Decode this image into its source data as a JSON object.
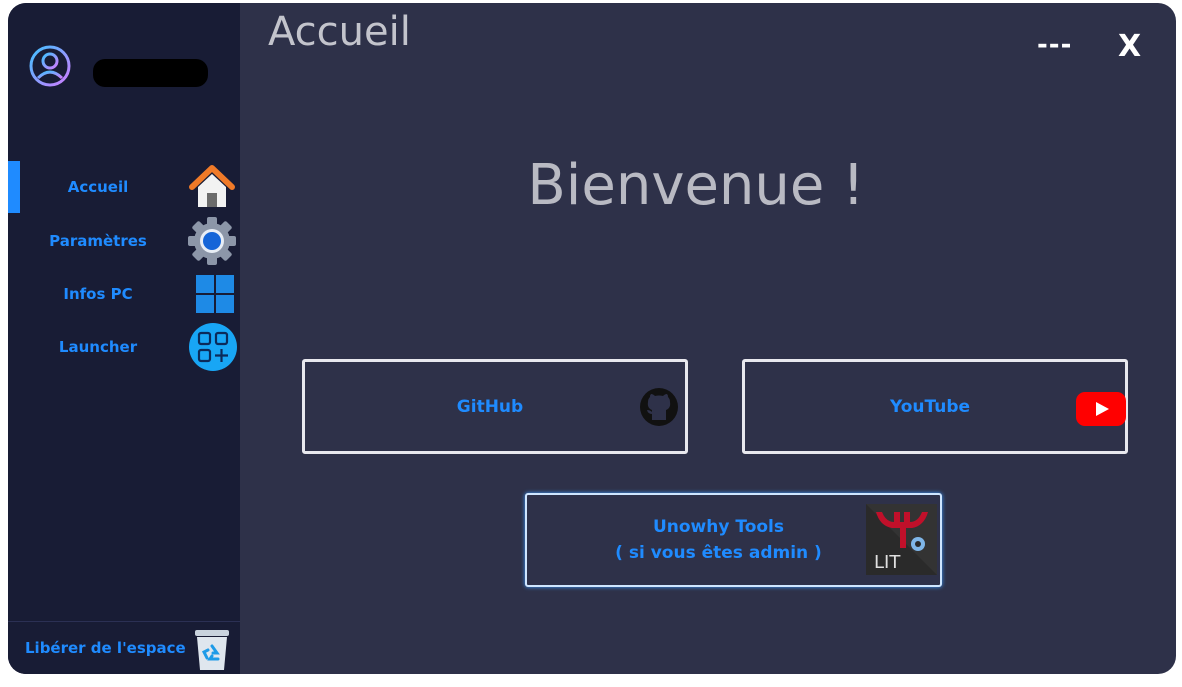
{
  "window": {
    "title": "Accueil",
    "minimize_label": "---",
    "close_label": "X"
  },
  "sidebar": {
    "items": [
      {
        "label": "Accueil",
        "icon": "home-icon",
        "active": true
      },
      {
        "label": "Paramètres",
        "icon": "gear-icon"
      },
      {
        "label": "Infos PC",
        "icon": "windows-icon"
      },
      {
        "label": "Launcher",
        "icon": "apps-icon"
      }
    ],
    "bottom": {
      "label": "Libérer de l'espace",
      "icon": "recycle-bin-icon"
    }
  },
  "main": {
    "welcome": "Bienvenue !",
    "links": {
      "github": {
        "label": "GitHub",
        "icon": "github-icon"
      },
      "youtube": {
        "label": "YouTube",
        "icon": "youtube-icon"
      },
      "unowhy": {
        "line1": "Unowhy Tools",
        "line2": "( si vous êtes admin )",
        "icon": "unowhy-tools-icon",
        "icon_text": "LIT"
      }
    }
  },
  "colors": {
    "accent": "#1f8bff",
    "sidebar_bg": "#181c35",
    "main_bg": "#2e3149",
    "title_text": "#c3c4cc"
  }
}
